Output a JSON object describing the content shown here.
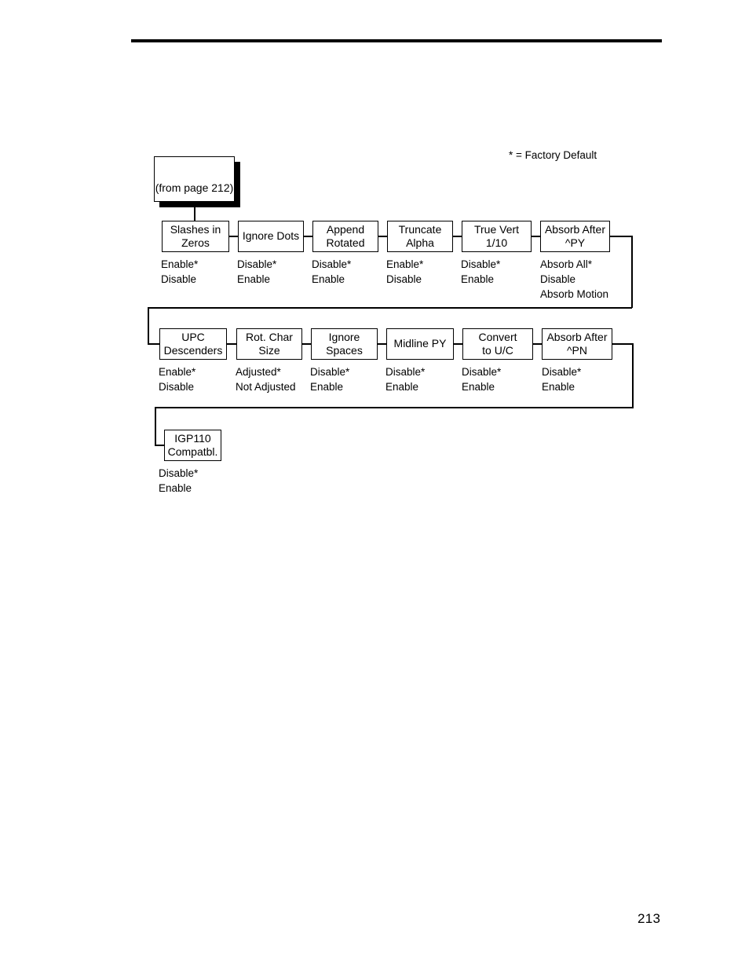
{
  "page": {
    "number": "213",
    "legend": "* = Factory Default"
  },
  "source_node": {
    "label": "(from page 212)"
  },
  "rows": [
    {
      "nodes": [
        {
          "line1": "Slashes in",
          "line2": "Zeros",
          "options": [
            "Enable*",
            "Disable"
          ]
        },
        {
          "line1": "Ignore Dots",
          "line2": "",
          "options": [
            "Disable*",
            "Enable"
          ]
        },
        {
          "line1": "Append",
          "line2": "Rotated",
          "options": [
            "Disable*",
            "Enable"
          ]
        },
        {
          "line1": "Truncate",
          "line2": "Alpha",
          "options": [
            "Enable*",
            "Disable"
          ]
        },
        {
          "line1": "True Vert",
          "line2": "1/10",
          "options": [
            "Disable*",
            "Enable"
          ]
        },
        {
          "line1": "Absorb After",
          "line2": "^PY",
          "options": [
            "Absorb All*",
            "Disable",
            "Absorb Motion"
          ]
        }
      ]
    },
    {
      "nodes": [
        {
          "line1": "UPC",
          "line2": "Descenders",
          "options": [
            "Enable*",
            "Disable"
          ]
        },
        {
          "line1": "Rot. Char",
          "line2": "Size",
          "options": [
            "Adjusted*",
            "Not Adjusted"
          ]
        },
        {
          "line1": "Ignore",
          "line2": "Spaces",
          "options": [
            "Disable*",
            "Enable"
          ]
        },
        {
          "line1": "Midline PY",
          "line2": "",
          "options": [
            "Disable*",
            "Enable"
          ]
        },
        {
          "line1": "Convert",
          "line2": "to U/C",
          "options": [
            "Disable*",
            "Enable"
          ]
        },
        {
          "line1": "Absorb After",
          "line2": "^PN",
          "options": [
            "Disable*",
            "Enable"
          ]
        }
      ]
    },
    {
      "nodes": [
        {
          "line1": "IGP110",
          "line2": "Compatbl.",
          "options": [
            "Disable*",
            "Enable"
          ]
        }
      ]
    }
  ]
}
